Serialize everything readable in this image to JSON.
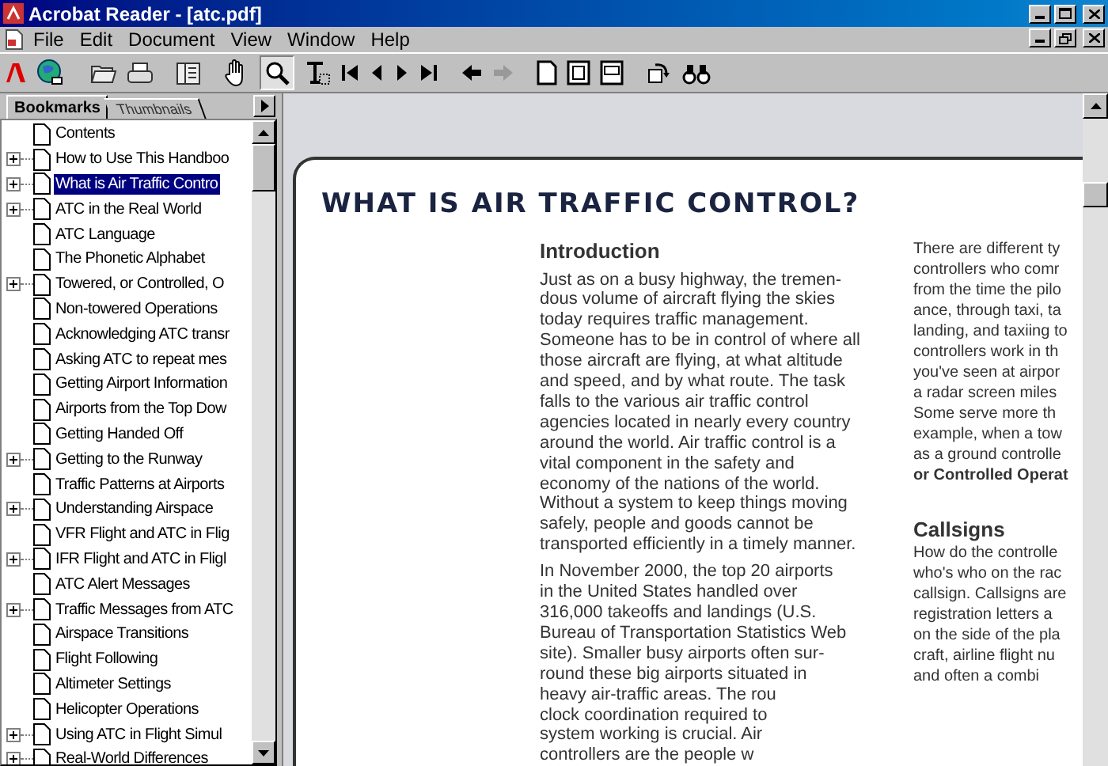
{
  "window": {
    "title": "Acrobat Reader - [atc.pdf]"
  },
  "menu": [
    {
      "label": "File"
    },
    {
      "label": "Edit"
    },
    {
      "label": "Document"
    },
    {
      "label": "View"
    },
    {
      "label": "Window"
    },
    {
      "label": "Help"
    }
  ],
  "panel_tabs": [
    {
      "label": "Bookmarks",
      "selected": true
    },
    {
      "label": "Thumbnails",
      "selected": false
    }
  ],
  "bookmarks": [
    {
      "label": "Contents",
      "expandable": false,
      "selected": false
    },
    {
      "label": "How to Use This Handboo",
      "expandable": true,
      "selected": false
    },
    {
      "label": "What is Air Traffic Contro",
      "expandable": true,
      "selected": true
    },
    {
      "label": "ATC in the Real World",
      "expandable": true,
      "selected": false
    },
    {
      "label": "ATC Language",
      "expandable": false,
      "selected": false
    },
    {
      "label": "The Phonetic Alphabet",
      "expandable": false,
      "selected": false
    },
    {
      "label": "Towered, or Controlled,  O",
      "expandable": true,
      "selected": false
    },
    {
      "label": "Non-towered Operations",
      "expandable": false,
      "selected": false
    },
    {
      "label": "Acknowledging ATC transr",
      "expandable": false,
      "selected": false
    },
    {
      "label": "Asking ATC to repeat mes",
      "expandable": false,
      "selected": false
    },
    {
      "label": "Getting Airport Information",
      "expandable": false,
      "selected": false
    },
    {
      "label": "Airports from the Top Dow",
      "expandable": false,
      "selected": false
    },
    {
      "label": "Getting Handed Off",
      "expandable": false,
      "selected": false
    },
    {
      "label": "Getting to the Runway",
      "expandable": true,
      "selected": false
    },
    {
      "label": "Traffic Patterns at Airports",
      "expandable": false,
      "selected": false
    },
    {
      "label": "Understanding Airspace",
      "expandable": true,
      "selected": false
    },
    {
      "label": "VFR Flight and ATC in  Flig",
      "expandable": false,
      "selected": false
    },
    {
      "label": "IFR Flight and ATC in  Fligl",
      "expandable": true,
      "selected": false
    },
    {
      "label": "ATC Alert Messages",
      "expandable": false,
      "selected": false
    },
    {
      "label": "Traffic Messages from ATC",
      "expandable": true,
      "selected": false
    },
    {
      "label": "Airspace Transitions",
      "expandable": false,
      "selected": false
    },
    {
      "label": "Flight Following",
      "expandable": false,
      "selected": false
    },
    {
      "label": "Altimeter Settings",
      "expandable": false,
      "selected": false
    },
    {
      "label": "Helicopter Operations",
      "expandable": false,
      "selected": false
    },
    {
      "label": "Using ATC in Flight  Simul",
      "expandable": true,
      "selected": false
    },
    {
      "label": "Real-World Differences",
      "expandable": true,
      "selected": false
    }
  ],
  "page": {
    "title": "WHAT IS AIR TRAFFIC CONTROL?",
    "column_1": [
      {
        "kind": "heading",
        "lines": [
          "Introduction"
        ]
      },
      {
        "kind": "paragraph",
        "lines": [
          "Just as on a busy highway, the tremen-",
          "dous volume of aircraft flying the skies",
          "today requires traffic management.",
          "Someone has to be in control of where all",
          "those aircraft are flying, at what altitude",
          "and speed, and by what route. The task",
          "falls to the various air traffic control",
          "agencies located in nearly every country",
          "around the world. Air traffic control is a",
          "vital component in the safety and",
          "economy of the nations of the world.",
          "Without a system to keep things moving",
          "safely, people and goods cannot be",
          "transported efficiently in a timely manner."
        ]
      },
      {
        "kind": "paragraph",
        "lines": [
          "In November 2000, the top 20 airports",
          "in the United States handled over",
          "316,000 takeoffs and landings (U.S.",
          "Bureau of Transportation Statistics Web",
          "site). Smaller busy airports often sur-",
          "round these big airports situated in",
          "heavy air-traffic areas. The rou",
          "clock coordination required to",
          "system working is crucial. Air",
          "controllers are the people w"
        ]
      }
    ],
    "column_2": [
      {
        "kind": "paragraph",
        "lines": [
          "There are different ty",
          "controllers who comr",
          "from the time the pilo",
          "ance, through taxi, ta",
          "landing, and taxiing to",
          "controllers work in th",
          "you've seen at airpor",
          "a radar screen miles",
          "Some serve more th",
          "example, when a tow",
          "as a ground controlle"
        ]
      },
      {
        "kind": "bold",
        "lines": [
          "or Controlled Operat"
        ]
      },
      {
        "kind": "heading",
        "lines": [
          "Callsigns"
        ]
      },
      {
        "kind": "paragraph",
        "lines": [
          "How do the controlle",
          "who's who on the rac",
          "callsign. Callsigns are",
          "registration letters a",
          "on the side of the pla",
          "craft, airline flight nu",
          "and often a combi"
        ]
      }
    ]
  }
}
